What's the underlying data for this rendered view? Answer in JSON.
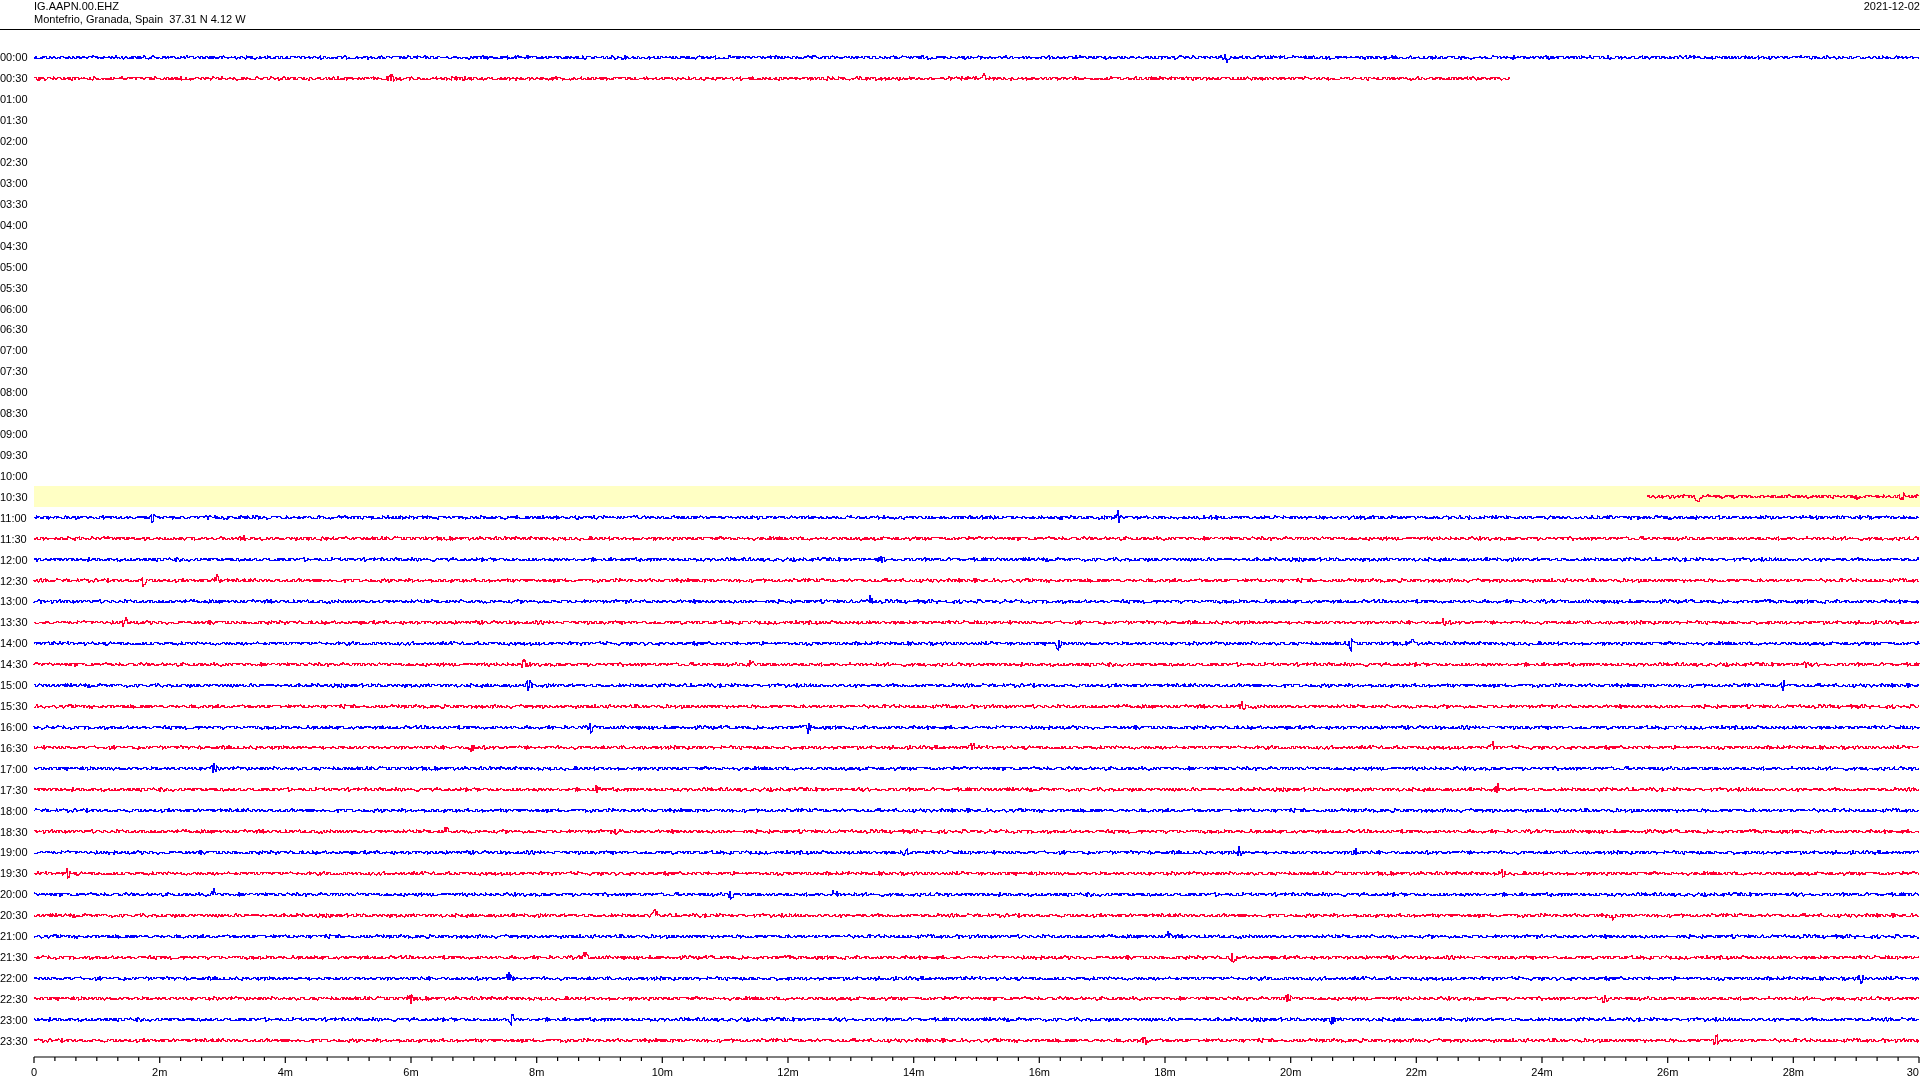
{
  "header": {
    "station": "IG.AAPN.00.EHZ",
    "location": "Montefrio, Granada, Spain  37.31 N 4.12 W",
    "date": "2021-12-02"
  },
  "rows": [
    {
      "label": "00:00",
      "color": "#0000ff",
      "kind": "full",
      "highlighted": false
    },
    {
      "label": "00:30",
      "color": "#ff0033",
      "kind": "ends-early",
      "highlighted": false
    },
    {
      "label": "01:00",
      "kind": "none",
      "highlighted": false
    },
    {
      "label": "01:30",
      "kind": "none",
      "highlighted": false
    },
    {
      "label": "02:00",
      "kind": "none",
      "highlighted": false
    },
    {
      "label": "02:30",
      "kind": "none",
      "highlighted": false
    },
    {
      "label": "03:00",
      "kind": "none",
      "highlighted": false
    },
    {
      "label": "03:30",
      "kind": "none",
      "highlighted": false
    },
    {
      "label": "04:00",
      "kind": "none",
      "highlighted": false
    },
    {
      "label": "04:30",
      "kind": "none",
      "highlighted": false
    },
    {
      "label": "05:00",
      "kind": "none",
      "highlighted": false
    },
    {
      "label": "05:30",
      "kind": "none",
      "highlighted": false
    },
    {
      "label": "06:00",
      "kind": "none",
      "highlighted": false
    },
    {
      "label": "06:30",
      "kind": "none",
      "highlighted": false
    },
    {
      "label": "07:00",
      "kind": "none",
      "highlighted": false
    },
    {
      "label": "07:30",
      "kind": "none",
      "highlighted": false
    },
    {
      "label": "08:00",
      "kind": "none",
      "highlighted": false
    },
    {
      "label": "08:30",
      "kind": "none",
      "highlighted": false
    },
    {
      "label": "09:00",
      "kind": "none",
      "highlighted": false
    },
    {
      "label": "09:30",
      "kind": "none",
      "highlighted": false
    },
    {
      "label": "10:00",
      "kind": "none",
      "highlighted": false
    },
    {
      "label": "10:30",
      "color": "#ff0033",
      "kind": "starts-late",
      "highlighted": true
    },
    {
      "label": "11:00",
      "color": "#0000ff",
      "kind": "full",
      "highlighted": false
    },
    {
      "label": "11:30",
      "color": "#ff0033",
      "kind": "full",
      "highlighted": false
    },
    {
      "label": "12:00",
      "color": "#0000ff",
      "kind": "full",
      "highlighted": false
    },
    {
      "label": "12:30",
      "color": "#ff0033",
      "kind": "full",
      "highlighted": false
    },
    {
      "label": "13:00",
      "color": "#0000ff",
      "kind": "full",
      "highlighted": false
    },
    {
      "label": "13:30",
      "color": "#ff0033",
      "kind": "full",
      "highlighted": false
    },
    {
      "label": "14:00",
      "color": "#0000ff",
      "kind": "full",
      "highlighted": false
    },
    {
      "label": "14:30",
      "color": "#ff0033",
      "kind": "full",
      "highlighted": false
    },
    {
      "label": "15:00",
      "color": "#0000ff",
      "kind": "full",
      "highlighted": false
    },
    {
      "label": "15:30",
      "color": "#ff0033",
      "kind": "full",
      "highlighted": false
    },
    {
      "label": "16:00",
      "color": "#0000ff",
      "kind": "full",
      "highlighted": false
    },
    {
      "label": "16:30",
      "color": "#ff0033",
      "kind": "full",
      "highlighted": false
    },
    {
      "label": "17:00",
      "color": "#0000ff",
      "kind": "full",
      "highlighted": false
    },
    {
      "label": "17:30",
      "color": "#ff0033",
      "kind": "full",
      "highlighted": false
    },
    {
      "label": "18:00",
      "color": "#0000ff",
      "kind": "full",
      "highlighted": false
    },
    {
      "label": "18:30",
      "color": "#ff0033",
      "kind": "full",
      "highlighted": false
    },
    {
      "label": "19:00",
      "color": "#0000ff",
      "kind": "full",
      "highlighted": false
    },
    {
      "label": "19:30",
      "color": "#ff0033",
      "kind": "full",
      "highlighted": false
    },
    {
      "label": "20:00",
      "color": "#0000ff",
      "kind": "full",
      "highlighted": false
    },
    {
      "label": "20:30",
      "color": "#ff0033",
      "kind": "full",
      "highlighted": false
    },
    {
      "label": "21:00",
      "color": "#0000ff",
      "kind": "full",
      "highlighted": false
    },
    {
      "label": "21:30",
      "color": "#ff0033",
      "kind": "full",
      "highlighted": false
    },
    {
      "label": "22:00",
      "color": "#0000ff",
      "kind": "full",
      "highlighted": false
    },
    {
      "label": "22:30",
      "color": "#ff0033",
      "kind": "full",
      "highlighted": false
    },
    {
      "label": "23:00",
      "color": "#0000ff",
      "kind": "full",
      "highlighted": false
    },
    {
      "label": "23:30",
      "color": "#ff0033",
      "kind": "full",
      "highlighted": false
    }
  ],
  "axis": {
    "ticks": [
      "0",
      "2m",
      "4m",
      "6m",
      "8m",
      "10m",
      "12m",
      "14m",
      "16m",
      "18m",
      "20m",
      "22m",
      "24m",
      "26m",
      "28m",
      "30"
    ]
  }
}
